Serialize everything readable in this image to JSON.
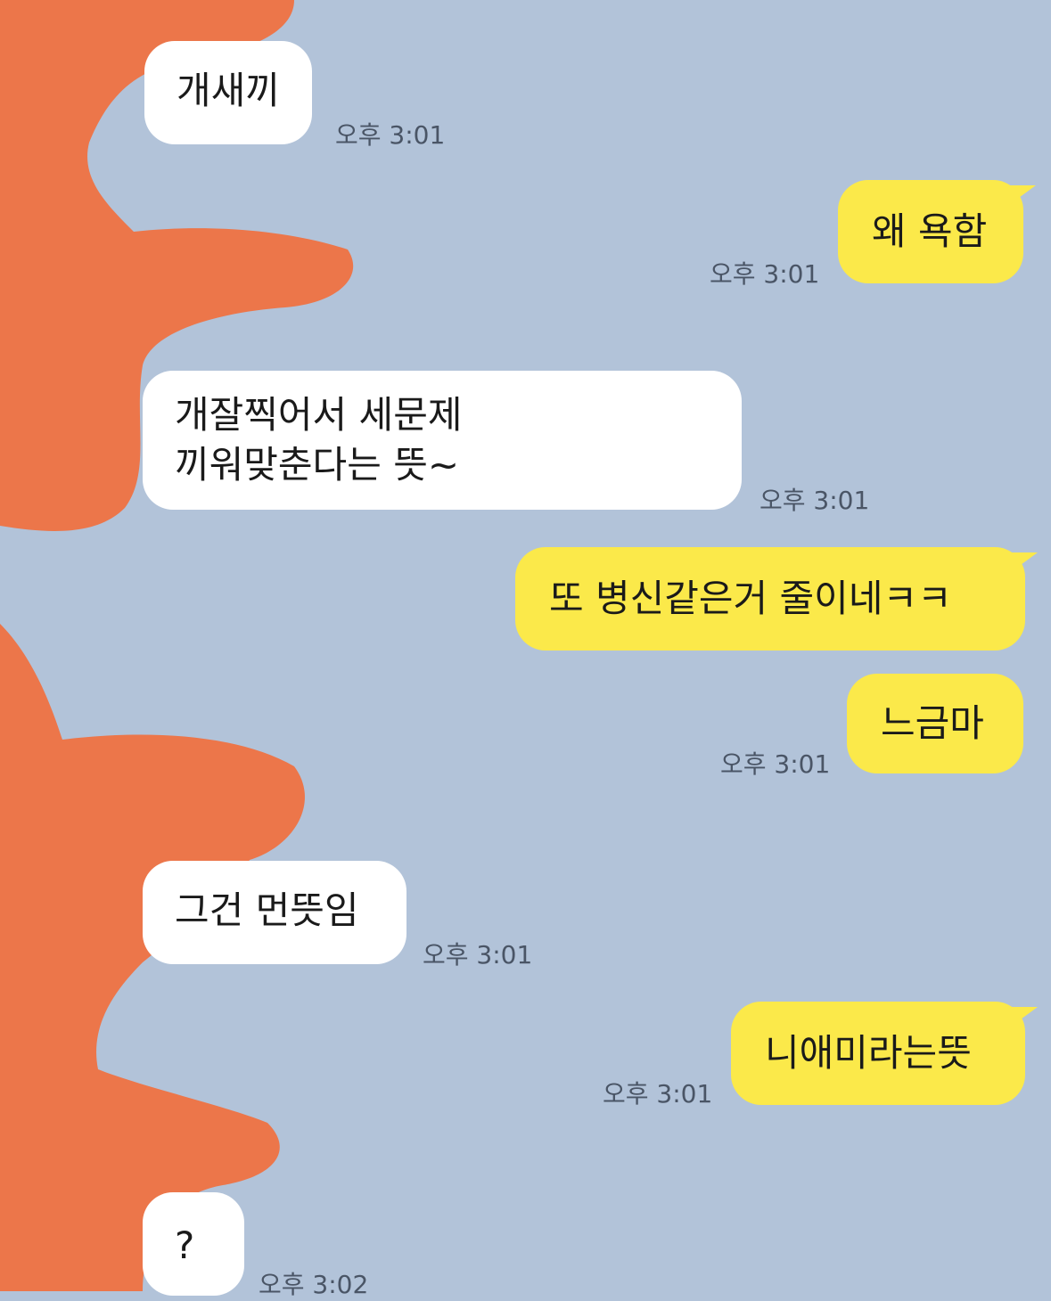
{
  "colors": {
    "chat_background": "#b2c3d9",
    "incoming_bubble": "#ffffff",
    "outgoing_bubble": "#fbe94a",
    "redaction_scribble": "#ec764a"
  },
  "messages": [
    {
      "direction": "incoming",
      "lines": [
        "개새끼"
      ],
      "time": "오후 3:01"
    },
    {
      "direction": "outgoing",
      "lines": [
        "왜 욕함"
      ],
      "time": "오후 3:01"
    },
    {
      "direction": "incoming",
      "lines": [
        "개잘찍어서 세문제",
        "끼워맞춘다는 뜻~"
      ],
      "time": "오후 3:01"
    },
    {
      "direction": "outgoing",
      "lines": [
        "또 병신같은거 줄이네ㅋㅋ"
      ],
      "time": ""
    },
    {
      "direction": "outgoing",
      "lines": [
        "느금마"
      ],
      "time": "오후 3:01"
    },
    {
      "direction": "incoming",
      "lines": [
        "그건 먼뜻임"
      ],
      "time": "오후 3:01"
    },
    {
      "direction": "outgoing",
      "lines": [
        "니애미라는뜻"
      ],
      "time": "오후 3:01"
    },
    {
      "direction": "incoming",
      "lines": [
        "?"
      ],
      "time": "오후 3:02"
    }
  ]
}
